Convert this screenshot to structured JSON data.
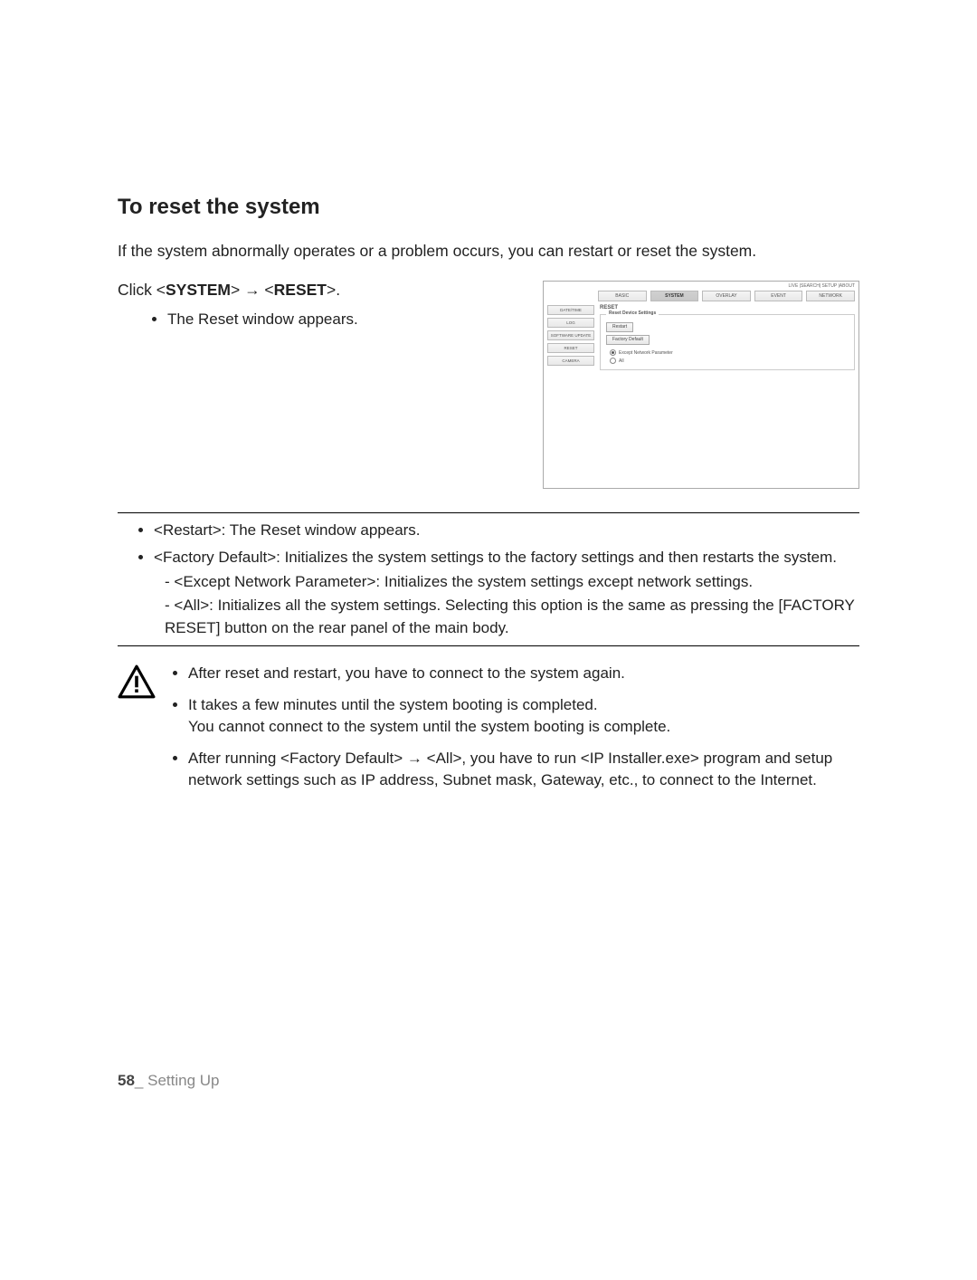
{
  "heading": "To reset the system",
  "intro": "If the system abnormally operates or a problem occurs, you can restart or reset the system.",
  "click_line": {
    "prefix": "Click <",
    "system": "SYSTEM",
    "mid1": "> ",
    "arrow": "→",
    "mid2": " <",
    "reset": "RESET",
    "suffix": ">."
  },
  "step_bullet": "The Reset window appears.",
  "screenshot": {
    "topbar": "LIVE  |SEARCH| SETUP  |ABOUT",
    "tabs": [
      "BASIC",
      "SYSTEM",
      "OVERLAY",
      "EVENT",
      "NETWORK"
    ],
    "active_tab_index": 1,
    "sidebar": [
      "DATE/TIME",
      "LOG",
      "SOFTWARE UPDATE",
      "RESET",
      "CAMERA"
    ],
    "content_title": "RESET",
    "fieldset_legend": "Reset Device Settings",
    "restart_btn": "Restart",
    "factory_btn": "Factory Default",
    "radio1": "Except Network Parameter",
    "radio2": "All"
  },
  "desc": {
    "restart": {
      "label": "Restart",
      "text": ": The Reset window appears."
    },
    "factory": {
      "label": "Factory Default",
      "text": ": Initializes the system settings to the factory settings and then restarts the system."
    },
    "except": {
      "label": "Except Network Parameter",
      "text": ": Initializes the system settings except network settings."
    },
    "all_pre": {
      "label": "All",
      "text": ": Initializes all the system settings. Selecting this option is the same as pressing the"
    },
    "all_btn_label": "FACTORY RESET",
    "all_post": " button on the rear panel of the main body."
  },
  "warnings": {
    "w1": "After reset and restart, you have to connect to the system again.",
    "w2a": "It takes a few minutes until the system booting is completed.",
    "w2b": "You cannot connect to the system until the system booting is complete.",
    "w3_pre": "After running <",
    "w3_fd": "Factory Default",
    "w3_mid1": "> ",
    "w3_arrow": "→",
    "w3_mid2": " <",
    "w3_all": "All",
    "w3_mid3": ">, you have to run <",
    "w3_ip": "IP Installer.exe",
    "w3_post": "> program and setup network settings such as IP address, Subnet mask, Gateway, etc., to connect to the Internet."
  },
  "footer": {
    "page": "58",
    "sep": "_",
    "section": " Setting Up"
  }
}
